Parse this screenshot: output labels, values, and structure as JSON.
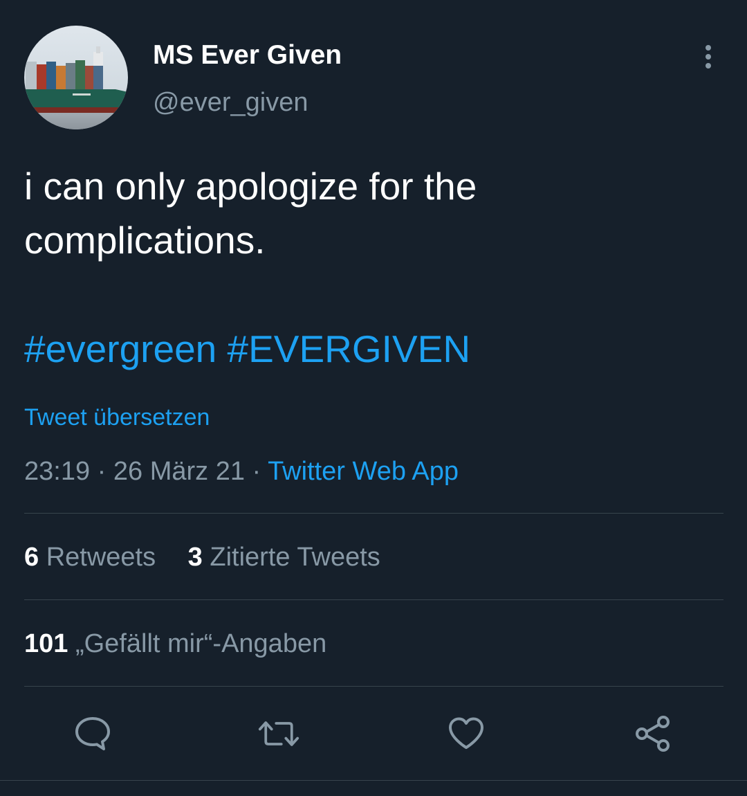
{
  "account": {
    "display_name": "MS Ever Given",
    "handle": "@ever_given",
    "avatar_icon": "container-ship-avatar"
  },
  "tweet": {
    "text": "i can only apologize for the complications.",
    "hashtags": [
      "#evergreen",
      "#EVERGIVEN"
    ],
    "translate_label": "Tweet übersetzen",
    "time": "23:19",
    "date": "26 März 21",
    "separator": "·",
    "source": "Twitter Web App"
  },
  "stats": {
    "retweets_count": "6",
    "retweets_label": "Retweets",
    "quotes_count": "3",
    "quotes_label": "Zitierte Tweets",
    "likes_count": "101",
    "likes_label": "„Gefällt mir“-Angaben"
  },
  "actions": [
    {
      "name": "reply",
      "icon": "speech-bubble-icon"
    },
    {
      "name": "retweet",
      "icon": "retweet-arrows-icon"
    },
    {
      "name": "like",
      "icon": "heart-icon"
    },
    {
      "name": "share",
      "icon": "share-nodes-icon"
    }
  ],
  "colors": {
    "background": "#16202b",
    "accent": "#1da1f2",
    "secondary_text": "#8899a6",
    "divider": "#38444d"
  },
  "more_menu_icon": "vertical-dots-icon"
}
